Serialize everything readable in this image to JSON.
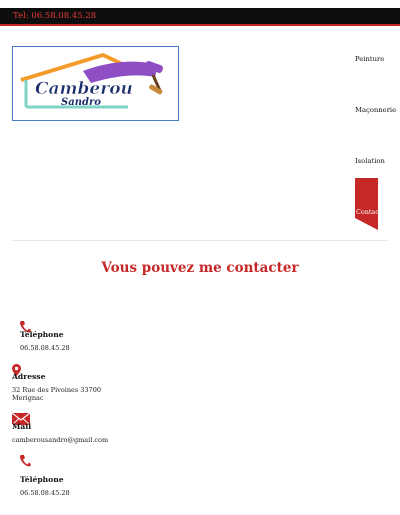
{
  "topbar": {
    "tel": "Tel: 06.58.08.45.28"
  },
  "logo": {
    "line1": "Camberou",
    "line2": "Sandro"
  },
  "nav": {
    "items": [
      "Peinture",
      "Maçonnerie",
      "Isolation"
    ],
    "contact": "Contact"
  },
  "contact": {
    "heading": "Vous pouvez me contacter",
    "phone": {
      "label": "Téléphone",
      "value": "06.58.08.45.28"
    },
    "address": {
      "label": "Adresse",
      "line1": "32 Rue des Pivoines 33700",
      "line2": "Merignac"
    },
    "mail": {
      "label": "Mail",
      "value": "camberousandro@gmail.com"
    },
    "phone2": {
      "label": "Téléphone",
      "value": "06.58.08.45.28"
    }
  },
  "colors": {
    "accent": "#c62828",
    "topbar": "#0d0d0d",
    "logo_border": "#4a78c7"
  },
  "icons": {
    "phone": "phone-icon",
    "address": "map-pin-icon",
    "mail": "mail-icon"
  }
}
